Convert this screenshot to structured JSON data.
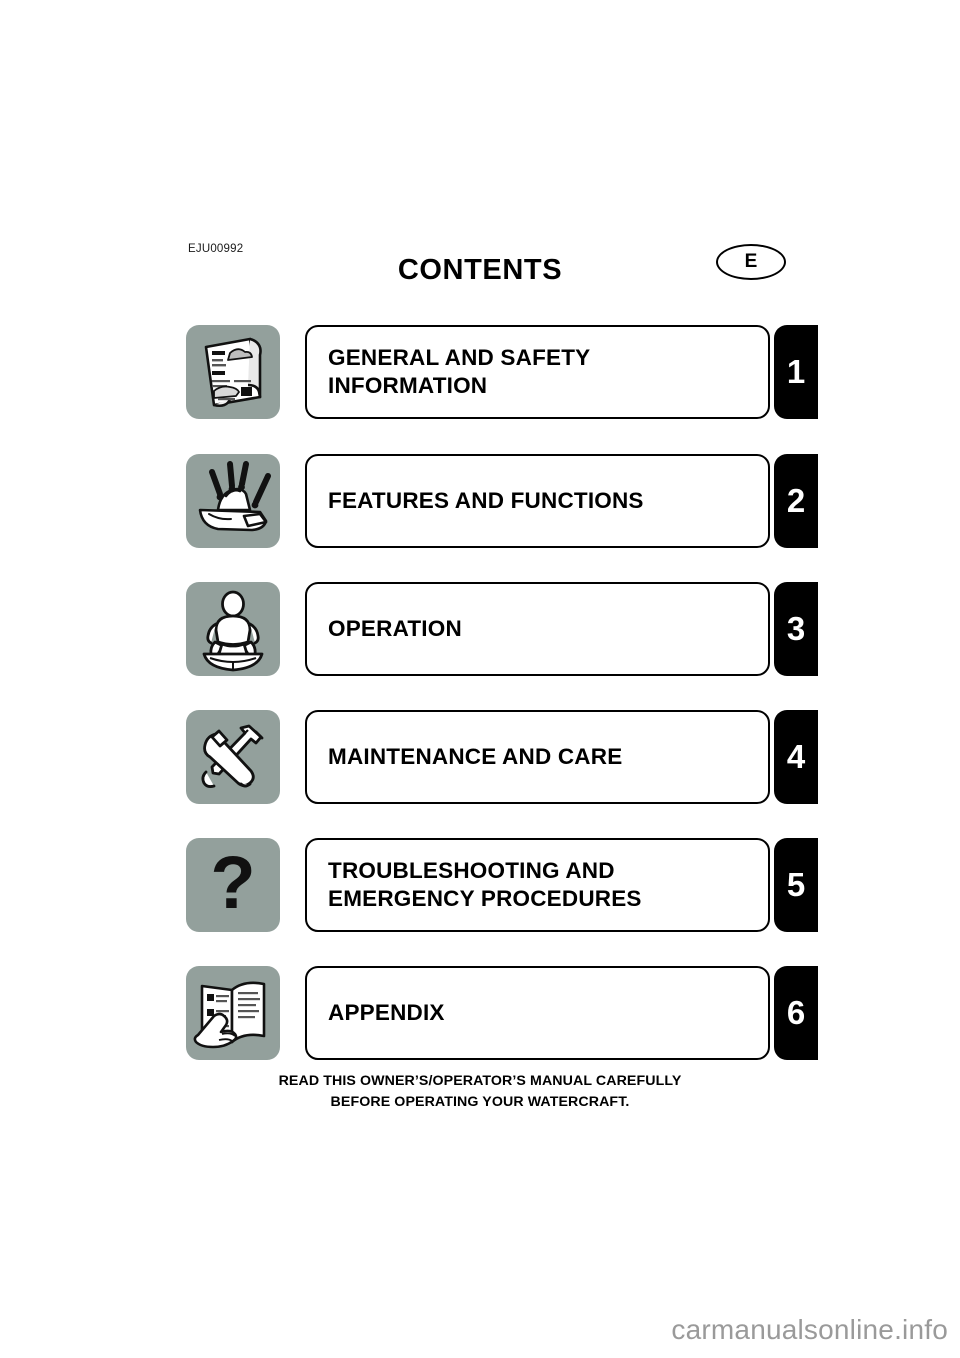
{
  "header": {
    "doc_code": "EJU00992",
    "title": "CONTENTS",
    "language_badge": "E"
  },
  "contents": {
    "rows": [
      {
        "number": "1",
        "label": "GENERAL AND SAFETY\nINFORMATION",
        "icon": "folded-manual-icon"
      },
      {
        "number": "2",
        "label": "FEATURES AND FUNCTIONS",
        "icon": "watercraft-features-icon"
      },
      {
        "number": "3",
        "label": "OPERATION",
        "icon": "rider-on-watercraft-icon"
      },
      {
        "number": "4",
        "label": "MAINTENANCE AND CARE",
        "icon": "wrench-and-tools-icon"
      },
      {
        "number": "5",
        "label": "TROUBLESHOOTING AND\nEMERGENCY PROCEDURES",
        "icon": "question-mark-icon"
      },
      {
        "number": "6",
        "label": "APPENDIX",
        "icon": "open-book-hand-icon"
      }
    ]
  },
  "footer": {
    "note": "READ THIS OWNER’S/OPERATOR’S MANUAL CAREFULLY\nBEFORE OPERATING YOUR WATERCRAFT."
  },
  "watermark": {
    "text": "carmanualsonline.info"
  },
  "colors": {
    "icon_background": "#93a09c",
    "tab_background": "#000000",
    "tab_text": "#ffffff",
    "page_background": "#ffffff",
    "watermark_text": "#9a9a9a"
  }
}
